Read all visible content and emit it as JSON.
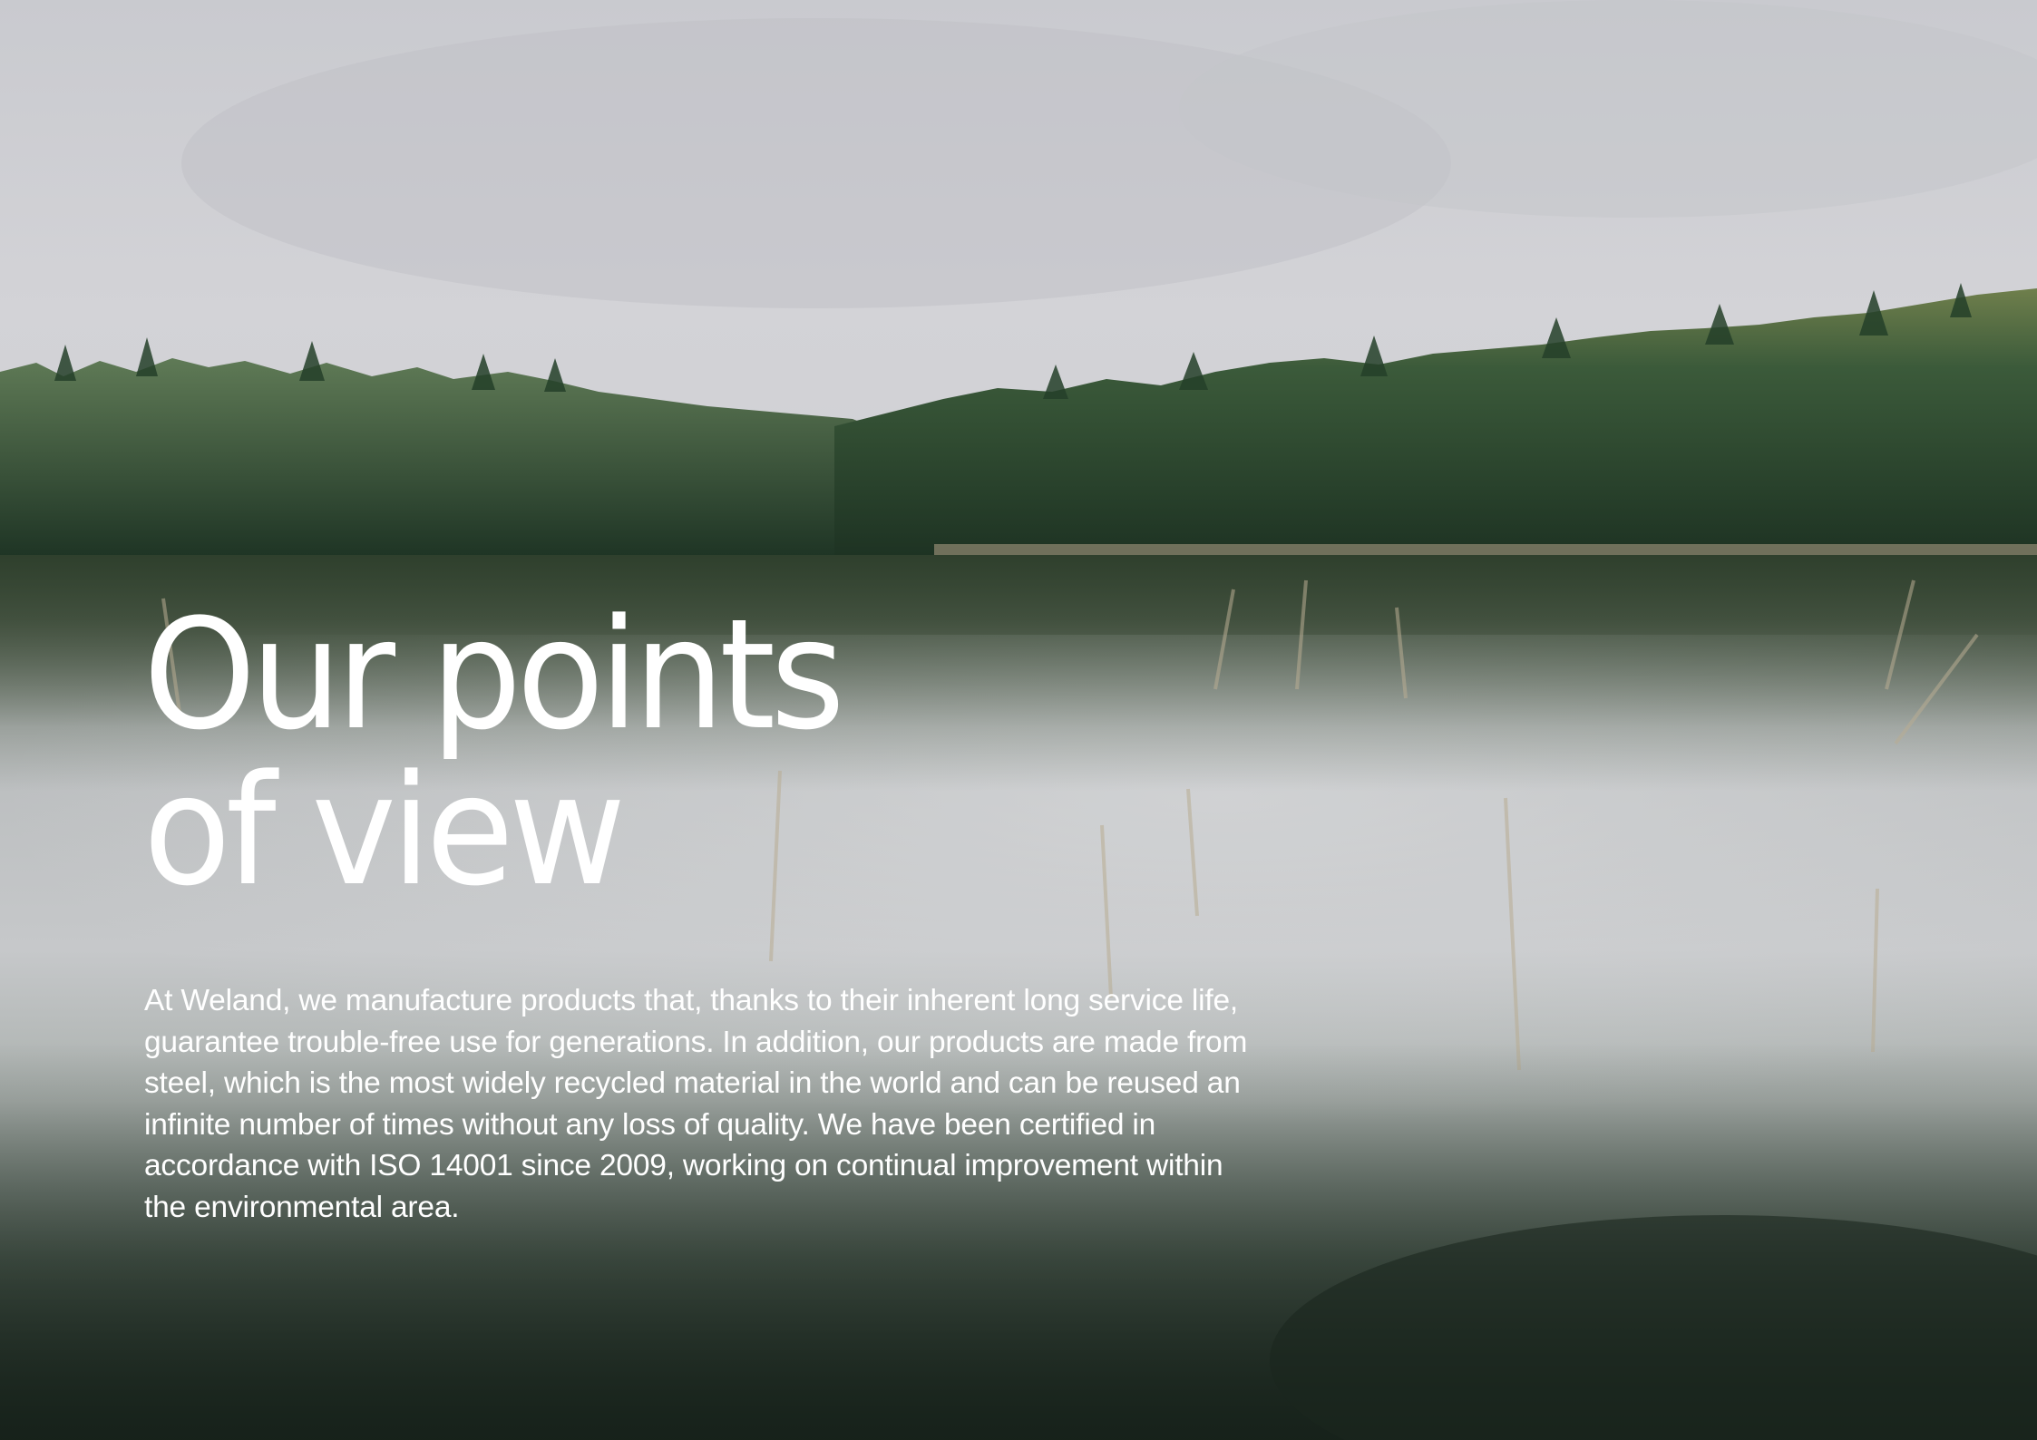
{
  "page": {
    "title_lines": [
      "Our points",
      "of view"
    ],
    "body": "At Weland, we manufacture products that, thanks to their inherent long service life, guarantee trouble-free use for generations. In addition, our products are made from steel, which is the most widely recycled material in the world and can be reused an infinite number of times without any loss of quality. We have been certified in accordance with ISO 14001 since 2009, working on continual improvement within the environmental area."
  },
  "colors": {
    "text": "#ffffff",
    "sky": "#cfd0d4",
    "forest": "#2f4a33",
    "water_dark": "#1f2b22"
  }
}
